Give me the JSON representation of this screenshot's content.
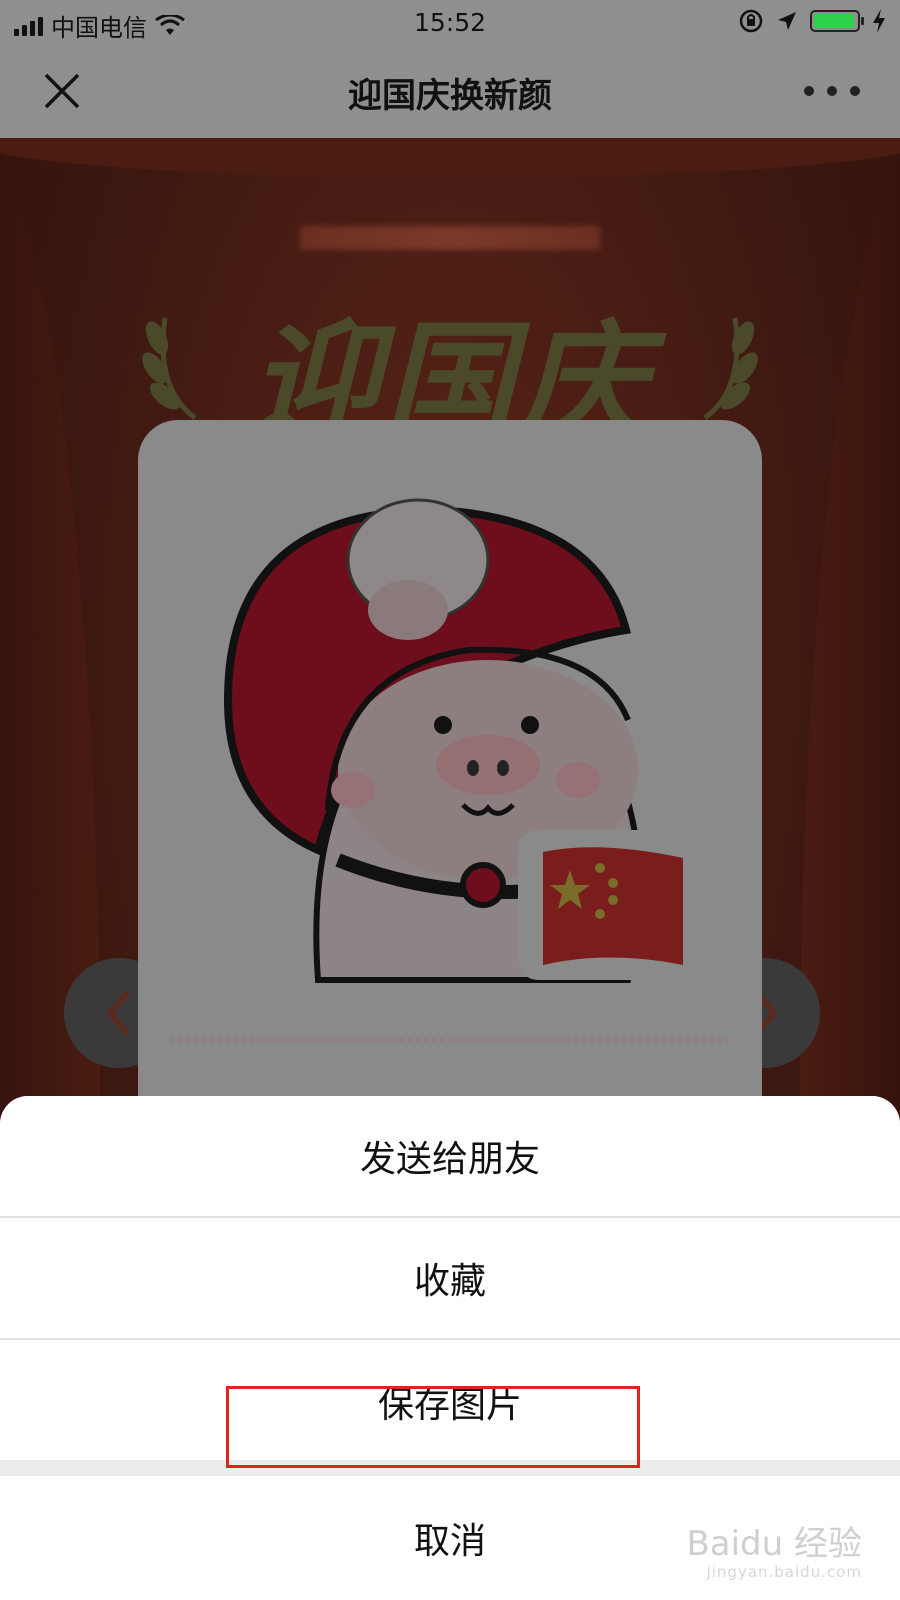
{
  "status_bar": {
    "carrier": "中国电信",
    "time": "15:52",
    "battery_color": "#2fd14a"
  },
  "nav": {
    "title": "迎国庆换新颜",
    "close_icon": "close-icon",
    "more_icon": "more-dots-icon"
  },
  "page": {
    "headline": "迎国庆"
  },
  "action_sheet": {
    "items": [
      {
        "label": "发送给朋友"
      },
      {
        "label": "收藏"
      },
      {
        "label": "保存图片"
      }
    ],
    "cancel_label": "取消",
    "highlight_color": "#e0231c"
  },
  "watermark": {
    "brand": "Baidu 经验",
    "url": "jingyan.baidu.com"
  }
}
